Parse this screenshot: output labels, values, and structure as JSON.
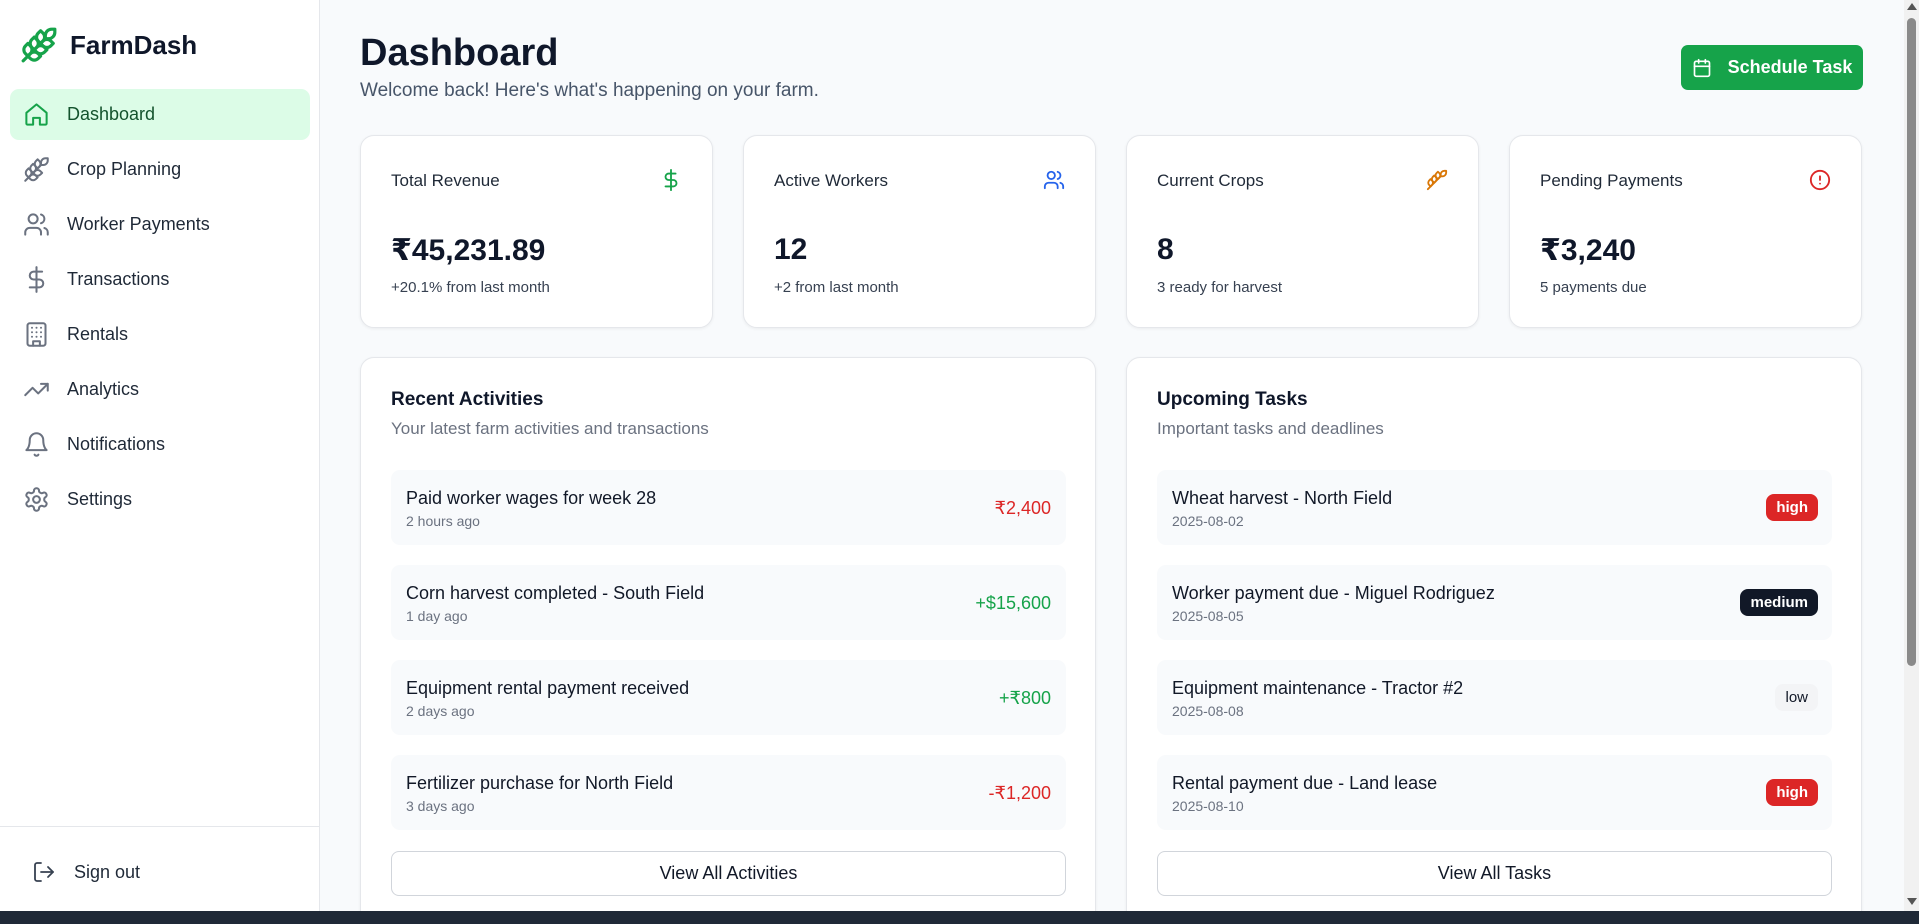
{
  "brand": {
    "name": "FarmDash"
  },
  "colors": {
    "accent": "#16a34a",
    "active_bg": "#dcfce7",
    "negative": "#dc2626",
    "positive": "#16a34a",
    "warning": "#d97706",
    "info": "#2563eb"
  },
  "sidebar": {
    "items": [
      {
        "label": "Dashboard",
        "icon": "home-icon",
        "active": true
      },
      {
        "label": "Crop Planning",
        "icon": "wheat-icon"
      },
      {
        "label": "Worker Payments",
        "icon": "users-icon"
      },
      {
        "label": "Transactions",
        "icon": "dollar-icon"
      },
      {
        "label": "Rentals",
        "icon": "building-icon"
      },
      {
        "label": "Analytics",
        "icon": "trending-up-icon"
      },
      {
        "label": "Notifications",
        "icon": "bell-icon"
      },
      {
        "label": "Settings",
        "icon": "gear-icon"
      }
    ],
    "signout_label": "Sign out"
  },
  "header": {
    "title": "Dashboard",
    "subtitle": "Welcome back! Here's what's happening on your farm.",
    "schedule_label": "Schedule Task"
  },
  "stats": [
    {
      "title": "Total Revenue",
      "value": "₹45,231.89",
      "note": "+20.1% from last month",
      "icon": "dollar-icon"
    },
    {
      "title": "Active Workers",
      "value": "12",
      "note": "+2 from last month",
      "icon": "users-icon"
    },
    {
      "title": "Current Crops",
      "value": "8",
      "note": "3 ready for harvest",
      "icon": "wheat-icon"
    },
    {
      "title": "Pending Payments",
      "value": "₹3,240",
      "note": "5 payments due",
      "icon": "alert-circle-icon"
    }
  ],
  "activities": {
    "title": "Recent Activities",
    "subtitle": "Your latest farm activities and transactions",
    "items": [
      {
        "title": "Paid worker wages for week 28",
        "time": "2 hours ago",
        "amount": "₹2,400",
        "tone": "negative"
      },
      {
        "title": "Corn harvest completed - South Field",
        "time": "1 day ago",
        "amount": "+$15,600",
        "tone": "positive"
      },
      {
        "title": "Equipment rental payment received",
        "time": "2 days ago",
        "amount": "+₹800",
        "tone": "positive"
      },
      {
        "title": "Fertilizer purchase for North Field",
        "time": "3 days ago",
        "amount": "-₹1,200",
        "tone": "negative"
      }
    ],
    "button_label": "View All Activities"
  },
  "tasks": {
    "title": "Upcoming Tasks",
    "subtitle": "Important tasks and deadlines",
    "items": [
      {
        "title": "Wheat harvest - North Field",
        "date": "2025-08-02",
        "priority": "high"
      },
      {
        "title": "Worker payment due - Miguel Rodriguez",
        "date": "2025-08-05",
        "priority": "medium"
      },
      {
        "title": "Equipment maintenance - Tractor #2",
        "date": "2025-08-08",
        "priority": "low"
      },
      {
        "title": "Rental payment due - Land lease",
        "date": "2025-08-10",
        "priority": "high"
      }
    ],
    "button_label": "View All Tasks"
  }
}
